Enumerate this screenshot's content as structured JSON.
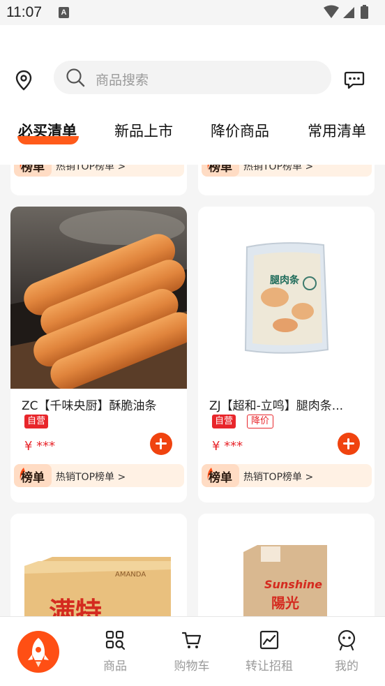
{
  "status": {
    "time": "11:07",
    "notif_letter": "A"
  },
  "search": {
    "placeholder": "商品搜索"
  },
  "tabs": [
    {
      "label": "必买清单",
      "active": true
    },
    {
      "label": "新品上市",
      "active": false
    },
    {
      "label": "降价商品",
      "active": false
    },
    {
      "label": "常用清单",
      "active": false
    }
  ],
  "rank": {
    "badge": "榜单",
    "text": "热销TOP榜单 >"
  },
  "products": [
    {
      "title": "ZC【千味央厨】酥脆油条",
      "self_tag": "自营",
      "price": "¥ ***"
    },
    {
      "title": "ZJ【超和-立鸣】腿肉条...",
      "self_tag": "自营",
      "drop_tag": "降价",
      "price": "¥ ***",
      "package_label": "腿肉条"
    }
  ],
  "next_products": [
    {
      "box_text": "满特",
      "box_brand": "AMANDA"
    },
    {
      "box_text": "陽光",
      "box_brand": "Sunshine"
    }
  ],
  "bottom_nav": [
    {
      "label": "商品",
      "icon": "grid-search-icon",
      "active": false
    },
    {
      "label": "购物车",
      "icon": "cart-icon",
      "active": false
    },
    {
      "label": "转让招租",
      "icon": "chart-icon",
      "active": false
    },
    {
      "label": "我的",
      "icon": "user-icon",
      "active": false
    }
  ],
  "colors": {
    "accent": "#ff5a1a",
    "price": "#e8262b",
    "rank_bg": "#fff1e4"
  }
}
